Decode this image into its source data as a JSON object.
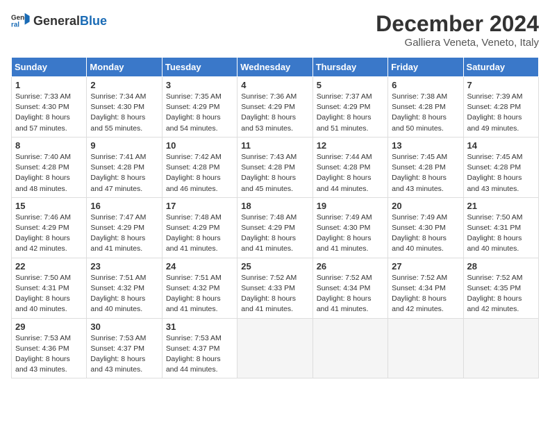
{
  "header": {
    "logo_general": "General",
    "logo_blue": "Blue",
    "month": "December 2024",
    "location": "Galliera Veneta, Veneto, Italy"
  },
  "columns": [
    "Sunday",
    "Monday",
    "Tuesday",
    "Wednesday",
    "Thursday",
    "Friday",
    "Saturday"
  ],
  "weeks": [
    [
      {
        "day": "1",
        "sunrise": "7:33 AM",
        "sunset": "4:30 PM",
        "daylight": "8 hours and 57 minutes."
      },
      {
        "day": "2",
        "sunrise": "7:34 AM",
        "sunset": "4:30 PM",
        "daylight": "8 hours and 55 minutes."
      },
      {
        "day": "3",
        "sunrise": "7:35 AM",
        "sunset": "4:29 PM",
        "daylight": "8 hours and 54 minutes."
      },
      {
        "day": "4",
        "sunrise": "7:36 AM",
        "sunset": "4:29 PM",
        "daylight": "8 hours and 53 minutes."
      },
      {
        "day": "5",
        "sunrise": "7:37 AM",
        "sunset": "4:29 PM",
        "daylight": "8 hours and 51 minutes."
      },
      {
        "day": "6",
        "sunrise": "7:38 AM",
        "sunset": "4:28 PM",
        "daylight": "8 hours and 50 minutes."
      },
      {
        "day": "7",
        "sunrise": "7:39 AM",
        "sunset": "4:28 PM",
        "daylight": "8 hours and 49 minutes."
      }
    ],
    [
      {
        "day": "8",
        "sunrise": "7:40 AM",
        "sunset": "4:28 PM",
        "daylight": "8 hours and 48 minutes."
      },
      {
        "day": "9",
        "sunrise": "7:41 AM",
        "sunset": "4:28 PM",
        "daylight": "8 hours and 47 minutes."
      },
      {
        "day": "10",
        "sunrise": "7:42 AM",
        "sunset": "4:28 PM",
        "daylight": "8 hours and 46 minutes."
      },
      {
        "day": "11",
        "sunrise": "7:43 AM",
        "sunset": "4:28 PM",
        "daylight": "8 hours and 45 minutes."
      },
      {
        "day": "12",
        "sunrise": "7:44 AM",
        "sunset": "4:28 PM",
        "daylight": "8 hours and 44 minutes."
      },
      {
        "day": "13",
        "sunrise": "7:45 AM",
        "sunset": "4:28 PM",
        "daylight": "8 hours and 43 minutes."
      },
      {
        "day": "14",
        "sunrise": "7:45 AM",
        "sunset": "4:28 PM",
        "daylight": "8 hours and 43 minutes."
      }
    ],
    [
      {
        "day": "15",
        "sunrise": "7:46 AM",
        "sunset": "4:29 PM",
        "daylight": "8 hours and 42 minutes."
      },
      {
        "day": "16",
        "sunrise": "7:47 AM",
        "sunset": "4:29 PM",
        "daylight": "8 hours and 41 minutes."
      },
      {
        "day": "17",
        "sunrise": "7:48 AM",
        "sunset": "4:29 PM",
        "daylight": "8 hours and 41 minutes."
      },
      {
        "day": "18",
        "sunrise": "7:48 AM",
        "sunset": "4:29 PM",
        "daylight": "8 hours and 41 minutes."
      },
      {
        "day": "19",
        "sunrise": "7:49 AM",
        "sunset": "4:30 PM",
        "daylight": "8 hours and 41 minutes."
      },
      {
        "day": "20",
        "sunrise": "7:49 AM",
        "sunset": "4:30 PM",
        "daylight": "8 hours and 40 minutes."
      },
      {
        "day": "21",
        "sunrise": "7:50 AM",
        "sunset": "4:31 PM",
        "daylight": "8 hours and 40 minutes."
      }
    ],
    [
      {
        "day": "22",
        "sunrise": "7:50 AM",
        "sunset": "4:31 PM",
        "daylight": "8 hours and 40 minutes."
      },
      {
        "day": "23",
        "sunrise": "7:51 AM",
        "sunset": "4:32 PM",
        "daylight": "8 hours and 40 minutes."
      },
      {
        "day": "24",
        "sunrise": "7:51 AM",
        "sunset": "4:32 PM",
        "daylight": "8 hours and 41 minutes."
      },
      {
        "day": "25",
        "sunrise": "7:52 AM",
        "sunset": "4:33 PM",
        "daylight": "8 hours and 41 minutes."
      },
      {
        "day": "26",
        "sunrise": "7:52 AM",
        "sunset": "4:34 PM",
        "daylight": "8 hours and 41 minutes."
      },
      {
        "day": "27",
        "sunrise": "7:52 AM",
        "sunset": "4:34 PM",
        "daylight": "8 hours and 42 minutes."
      },
      {
        "day": "28",
        "sunrise": "7:52 AM",
        "sunset": "4:35 PM",
        "daylight": "8 hours and 42 minutes."
      }
    ],
    [
      {
        "day": "29",
        "sunrise": "7:53 AM",
        "sunset": "4:36 PM",
        "daylight": "8 hours and 43 minutes."
      },
      {
        "day": "30",
        "sunrise": "7:53 AM",
        "sunset": "4:37 PM",
        "daylight": "8 hours and 43 minutes."
      },
      {
        "day": "31",
        "sunrise": "7:53 AM",
        "sunset": "4:37 PM",
        "daylight": "8 hours and 44 minutes."
      },
      null,
      null,
      null,
      null
    ]
  ]
}
